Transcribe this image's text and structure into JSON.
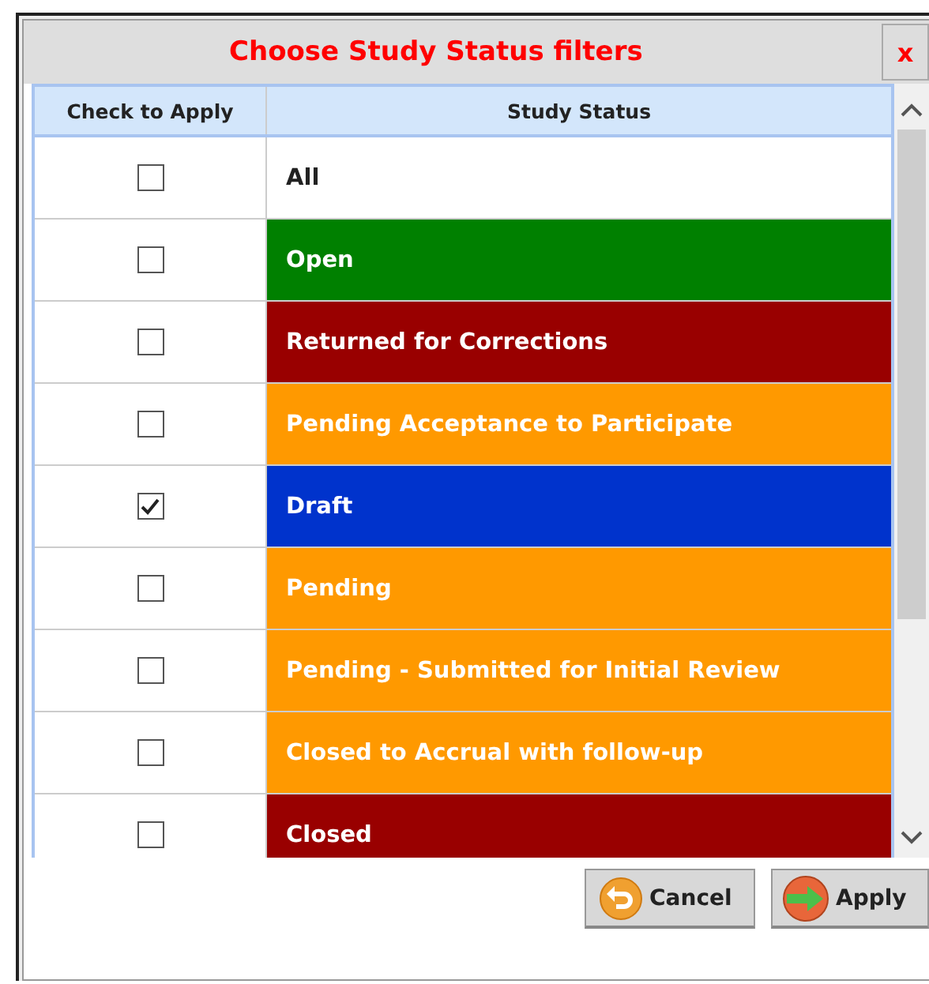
{
  "dialog": {
    "title": "Choose Study Status filters",
    "close": "x"
  },
  "table": {
    "columns": [
      "Check to Apply",
      "Study Status"
    ],
    "rows": [
      {
        "status": "All",
        "color": "#ffffff",
        "checked": false
      },
      {
        "status": "Open",
        "color": "#008000",
        "checked": false
      },
      {
        "status": "Returned for Corrections",
        "color": "#990000",
        "checked": false
      },
      {
        "status": "Pending Acceptance to Participate",
        "color": "#ff9900",
        "checked": false
      },
      {
        "status": "Draft",
        "color": "#0033cc",
        "checked": true
      },
      {
        "status": "Pending",
        "color": "#ff9900",
        "checked": false
      },
      {
        "status": "Pending - Submitted for Initial Review",
        "color": "#ff9900",
        "checked": false
      },
      {
        "status": "Closed to Accrual with follow-up",
        "color": "#ff9900",
        "checked": false
      },
      {
        "status": "Closed",
        "color": "#990000",
        "checked": false
      }
    ]
  },
  "buttons": [
    {
      "kind": "cancel",
      "label": "Cancel"
    },
    {
      "kind": "apply",
      "label": "Apply"
    }
  ]
}
